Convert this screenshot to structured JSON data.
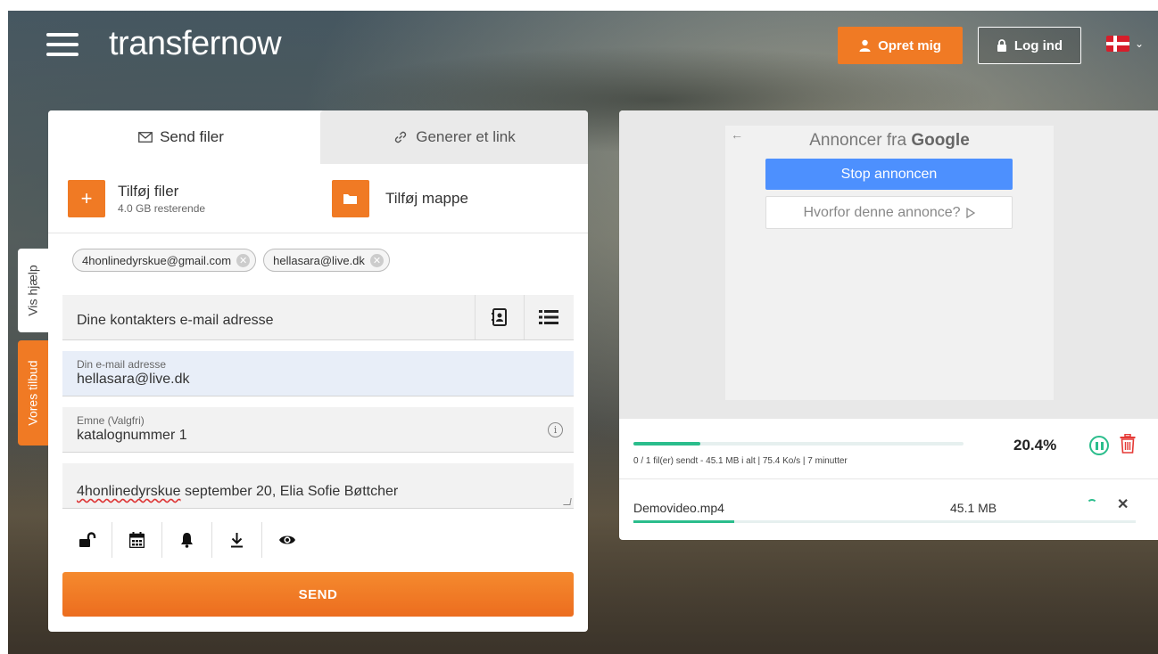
{
  "brand": {
    "logo_text": "transfernow"
  },
  "header": {
    "register_label": "Opret mig",
    "login_label": "Log ind",
    "flag_colors": {
      "red": "#d71e2b",
      "white": "#ffffff"
    }
  },
  "side": {
    "help_label": "Vis hjælp",
    "offers_label": "Vores tilbud"
  },
  "tabs": {
    "send_label": "Send filer",
    "link_label": "Generer et link"
  },
  "add": {
    "files_label": "Tilføj filer",
    "files_sub": "4.0 GB resterende",
    "folder_label": "Tilføj mappe"
  },
  "recipients": [
    "4honlinedyrskue@gmail.com",
    "hellasara@live.dk"
  ],
  "contacts_placeholder": "Dine kontakters e-mail adresse",
  "email": {
    "label": "Din e-mail adresse",
    "value": "hellasara@live.dk"
  },
  "subject": {
    "label": "Emne (Valgfri)",
    "value": "katalognummer 1"
  },
  "message": {
    "spell_word": "4honlinedyrskue",
    "rest": " september 20, Elia Sofie Bøttcher"
  },
  "send_label": "SEND",
  "ad": {
    "title_prefix": "Annoncer fra ",
    "title_brand": "Google",
    "stop_label": "Stop annoncen",
    "why_label": "Hvorfor denne annonce?"
  },
  "upload": {
    "progress": 0.204,
    "percent_label": "20.4%",
    "info": "0 / 1 fil(er) sendt - 45.1 MB i alt | 75.4 Ko/s | 7 minutter"
  },
  "file": {
    "name": "Demovideo.mp4",
    "size": "45.1 MB",
    "progress": 0.2
  },
  "colors": {
    "accent": "#f07a24",
    "success": "#2bbd8c",
    "danger": "#e53935",
    "google_blue": "#4d90fe"
  }
}
